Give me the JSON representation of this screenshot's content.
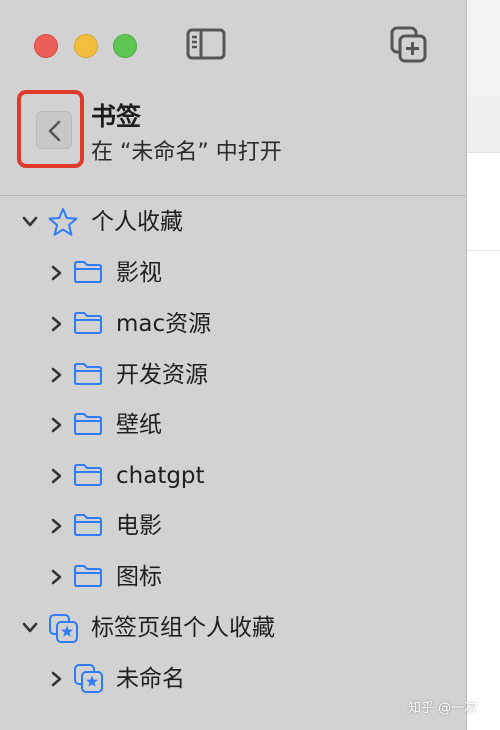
{
  "header": {
    "title": "书签",
    "subtitle": "在 “未命名” 中打开"
  },
  "toolbar": {
    "sidebar_toggle_icon": "sidebar-toggle-icon",
    "new_tab_icon": "tab-group-new-icon"
  },
  "bookmarks": {
    "favorites": {
      "label": "个人收藏",
      "icon": "star-icon",
      "expanded": true,
      "folders": [
        {
          "label": "影视"
        },
        {
          "label": "mac资源"
        },
        {
          "label": "开发资源"
        },
        {
          "label": "壁纸"
        },
        {
          "label": "chatgpt"
        },
        {
          "label": "电影"
        },
        {
          "label": "图标"
        }
      ]
    },
    "tab_group_favorites": {
      "label": "标签页组个人收藏",
      "icon": "tab-group-star-icon",
      "expanded": true,
      "items": [
        {
          "label": "未命名"
        }
      ]
    }
  },
  "watermark": "知乎 @一次",
  "colors": {
    "sidebar_bg": "#d2d2d2",
    "accent_blue": "#2f7cf6",
    "highlight_red": "#e03a2a"
  }
}
